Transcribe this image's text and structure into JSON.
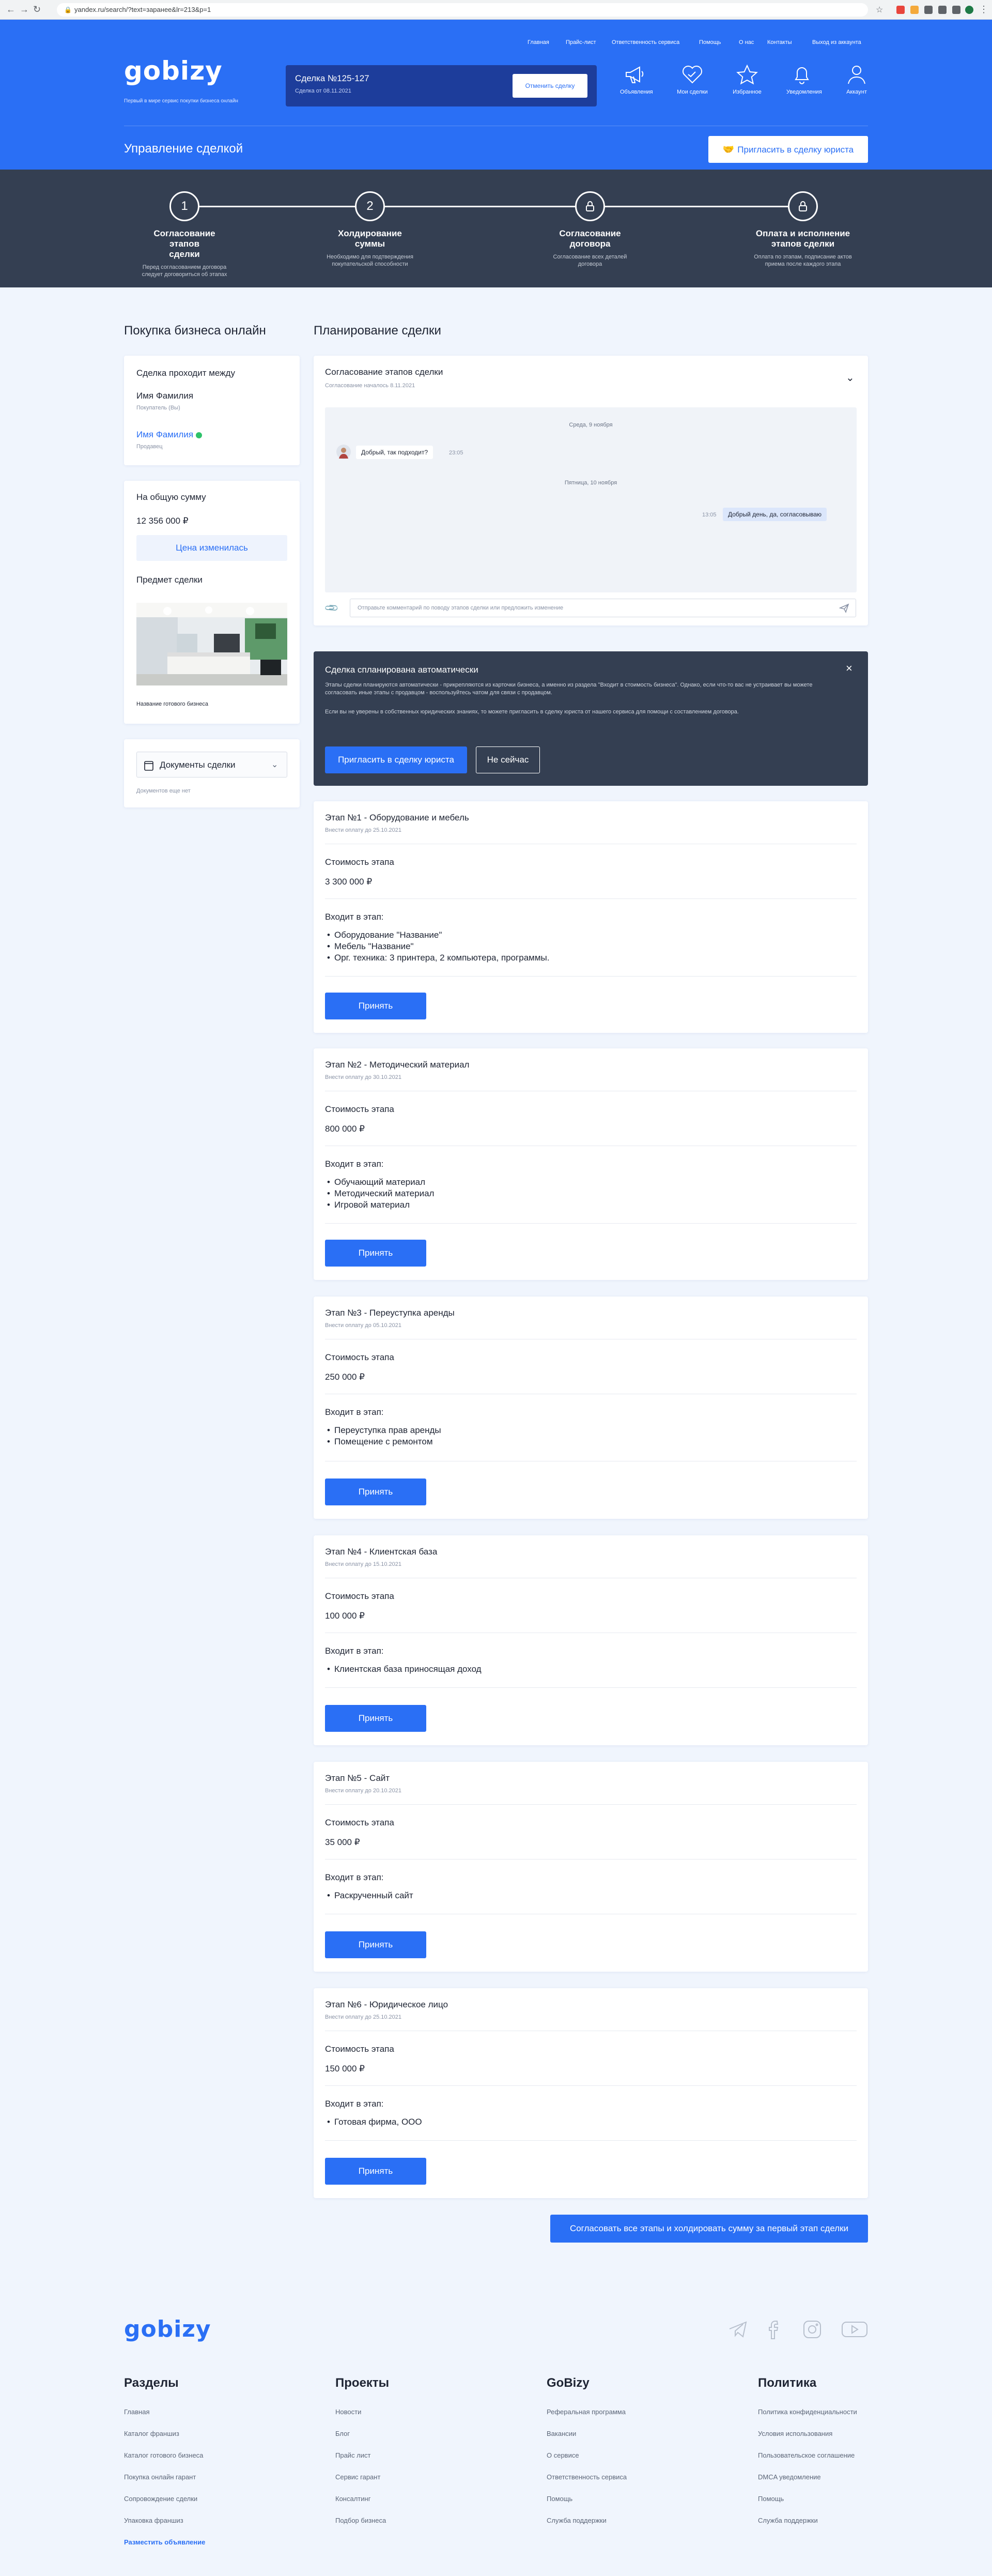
{
  "browser": {
    "url": "yandex.ru/search/?text=заранее&lr=213&p=1"
  },
  "header": {
    "nav_links": [
      "Главная",
      "Прайс-лист",
      "Ответственность сервиса",
      "Помощь",
      "О нас",
      "Контакты",
      "Выход из аккаунта"
    ],
    "logo": "gobizy",
    "logo_subtitle": "Первый в мире сервис покупки бизнеса онлайн",
    "deal_title": "Сделка №125-127",
    "deal_date": "Сделка от 08.11.2021",
    "cancel_label": "Отменить сделку",
    "icons": [
      "Объявления",
      "Мои сделки",
      "Избранное",
      "Уведомления",
      "Аккаунт"
    ],
    "manage_title": "Управление сделкой",
    "invite_lawyer_label": "Пригласить в сделку юриста"
  },
  "steps": [
    {
      "num": "1",
      "title": "Согласование этапов сделки",
      "desc": "Перед согласованием договора следует договориться об этапах"
    },
    {
      "num": "2",
      "title": "Холдирование суммы",
      "desc": "Необходимо для подтверждения покупательской способности"
    },
    {
      "num": "",
      "title": "Согласование договора",
      "desc": "Согласование всех деталей договора"
    },
    {
      "num": "",
      "title": "Оплата и исполнение этапов сделки",
      "desc": "Оплата по этапам, подписание актов приема после каждого этапа"
    }
  ],
  "sidebar": {
    "title": "Покупка бизнеса онлайн",
    "parties_title": "Сделка проходит между",
    "buyer_name": "Имя Фамилия",
    "buyer_role": "Покупатель (Вы)",
    "seller_name": "Имя Фамилия",
    "seller_role": "Продавец",
    "sum_label": "На общую сумму",
    "sum_value": "12 356 000 ₽",
    "price_changed": "Цена изменилась",
    "subject_label": "Предмет сделки",
    "business_name": "Название готового бизнеса",
    "docs_label": "Документы сделки",
    "docs_note": "Документов еще нет"
  },
  "main": {
    "title": "Планирование сделки",
    "chat": {
      "title": "Согласование этапов сделки",
      "subtitle": "Согласование началось 8.11.2021",
      "day1": "Среда, 9 ноября",
      "msg1": "Добрый, так подходит?",
      "time1": "23:05",
      "day2": "Пятница, 10 ноября",
      "msg2": "Добрый день, да, согласовываю",
      "time2": "13:05",
      "input_placeholder": "Отправьте комментарий по поводу этапов сделки или предложить изменение"
    },
    "auto": {
      "title": "Сделка спланирована автоматически",
      "p1": "Этапы сделки планируются автоматически - прикрепляются из карточки бизнеса, а именно из раздела \"Входит в стоимость бизнеса\". Однако, если что-то вас не устраивает вы можете согласовать иные этапы с продавцом - воспользуйтесь чатом для связи с продавцом.",
      "p2": "Если вы не уверены в собственных юридических знаниях, то можете пригласить в сделку юриста от нашего сервиса для помощи с составлением договора.",
      "invite_label": "Пригласить в сделку юриста",
      "later_label": "Не сейчас"
    },
    "stage_cost_label": "Стоимость этапа",
    "stage_includes_label": "Входит в этап:",
    "accept_label": "Принять",
    "stages": [
      {
        "title": "Этап №1 - Оборудование и мебель",
        "deadline": "Внести оплату до 25.10.2021",
        "cost": "3 300 000 ₽",
        "items": [
          "Оборудование \"Название\"",
          "Мебель \"Название\"",
          "Орг. техника: 3 принтера, 2 компьютера, программы."
        ]
      },
      {
        "title": "Этап №2 - Методический материал",
        "deadline": "Внести оплату до 30.10.2021",
        "cost": "800 000 ₽",
        "items": [
          "Обучающий материал",
          "Методический материал",
          "Игровой материал"
        ]
      },
      {
        "title": "Этап №3 - Переуступка аренды",
        "deadline": "Внести оплату до 05.10.2021",
        "cost": "250 000 ₽",
        "items": [
          "Переуступка прав аренды",
          "Помещение с ремонтом"
        ]
      },
      {
        "title": "Этап №4 - Клиентская база",
        "deadline": "Внести оплату до 15.10.2021",
        "cost": "100 000 ₽",
        "items": [
          "Клиентская база приносящая доход"
        ]
      },
      {
        "title": "Этап №5 - Сайт",
        "deadline": "Внести оплату до 20.10.2021",
        "cost": "35 000 ₽",
        "items": [
          "Раскрученный сайт"
        ]
      },
      {
        "title": "Этап №6 - Юридическое лицо",
        "deadline": "Внести оплату до 25.10.2021",
        "cost": "150 000 ₽",
        "items": [
          "Готовая фирма, ООО"
        ]
      }
    ],
    "confirm_all_label": "Согласовать все этапы и холдировать сумму за первый этап сделки"
  },
  "footer": {
    "logo": "gobizy",
    "columns": [
      {
        "title": "Разделы",
        "links": [
          "Главная",
          "Каталог франшиз",
          "Каталог готового бизнеса",
          "Покупка онлайн гарант",
          "Сопровождение сделки",
          "Упаковка франшиз",
          "Разместить объявление"
        ]
      },
      {
        "title": "Проекты",
        "links": [
          "Новости",
          "Блог",
          "Прайс лист",
          "Сервис гарант",
          "Консалтинг",
          "Подбор бизнеса"
        ]
      },
      {
        "title": "GoBizy",
        "links": [
          "Реферальная программа",
          "Вакансии",
          "О сервисе",
          "Ответственность сервиса",
          "Помощь",
          "Служба поддержки"
        ]
      },
      {
        "title": "Политика",
        "links": [
          "Политика конфиденциальности",
          "Условия использования",
          "Пользовательское соглашение",
          "DMCA уведомление",
          "Помощь",
          "Служба поддержки"
        ]
      }
    ]
  },
  "colors": {
    "brand": "#2a6ff5",
    "dark": "#343f52",
    "bg": "#f0f5fd"
  }
}
